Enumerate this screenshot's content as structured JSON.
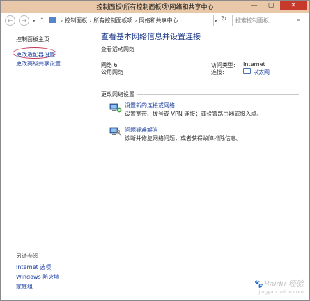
{
  "window": {
    "title": "控制面板\\所有控制面板项\\网络和共享中心",
    "buttons": {
      "minimize": "—",
      "maximize": "▢",
      "close": "✕"
    }
  },
  "addressbar": {
    "back": "←",
    "forward": "→",
    "up": "↑",
    "dropdown": "▾",
    "crumbs": [
      "控制面板",
      "所有控制面板项",
      "网络和共享中心"
    ],
    "refresh": "↻",
    "search_placeholder": "搜索控制面板",
    "search_icon": "magnifier-icon"
  },
  "left_pane": {
    "home": "控制面板主页",
    "adapter_settings": "更改适配器设置",
    "sharing_settings": "更改高级共享设置",
    "see_also_title": "另请参阅",
    "see_also": [
      "Internet 选项",
      "Windows 防火墙",
      "家庭组"
    ]
  },
  "main": {
    "title": "查看基本网络信息并设置连接",
    "active_networks_header": "查看活动网络",
    "network": {
      "name": "网络 6",
      "type": "公用网络",
      "access_label": "访问类型:",
      "access_value": "Internet",
      "connection_label": "连接:",
      "connection_value": "以太网"
    },
    "change_settings_header": "更改网络设置",
    "tasks": [
      {
        "title": "设置新的连接或网络",
        "desc": "设置宽带、拨号或 VPN 连接；或设置路由器或接入点。",
        "icon": "network-setup-icon"
      },
      {
        "title": "问题疑难解答",
        "desc": "诊断并修复网络问题，或者获得故障排除信息。",
        "icon": "troubleshoot-icon"
      }
    ]
  },
  "watermark": {
    "text": "Baidu 经验",
    "sub": "jingyan.baidu.com"
  },
  "colors": {
    "title_bar": "#e8c8a8",
    "link": "#1b3ea0",
    "page_title": "#1e3c88",
    "highlight_circle": "#c23a5a",
    "close_button": "#c7392b"
  }
}
